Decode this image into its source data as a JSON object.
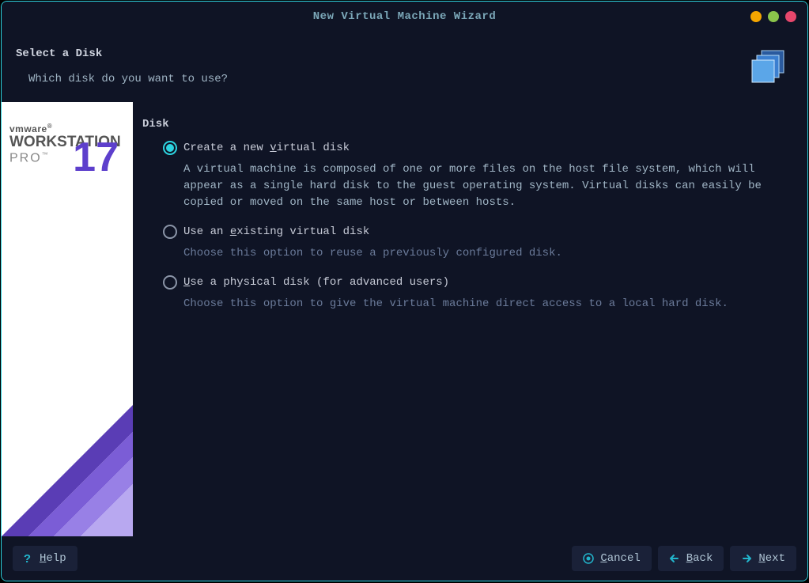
{
  "window": {
    "title": "New Virtual Machine Wizard"
  },
  "header": {
    "title": "Select a Disk",
    "subtitle": "Which disk do you want to use?"
  },
  "sidebar": {
    "brand_small": "vmware",
    "brand_big": "WORKSTATION",
    "brand_pro": "PRO",
    "version": "17"
  },
  "content": {
    "section_title": "Disk",
    "options": [
      {
        "id": "create-new",
        "label_pre": "Create a new ",
        "mnemonic": "v",
        "label_post": "irtual disk",
        "description": "A virtual machine is composed of one or more files on the host file system, which will appear as a single hard disk to the guest operating system. Virtual disks can easily be copied or moved on the same host or between hosts.",
        "selected": true
      },
      {
        "id": "use-existing",
        "label_pre": "Use an ",
        "mnemonic": "e",
        "label_post": "xisting virtual disk",
        "description": "Choose this option to reuse a previously configured disk.",
        "selected": false
      },
      {
        "id": "use-physical",
        "label_pre": "",
        "mnemonic": "U",
        "label_post": "se a physical disk (for advanced users)",
        "description": "Choose this option to give the virtual machine direct access to a local hard disk.",
        "selected": false
      }
    ]
  },
  "footer": {
    "help_label": "elp",
    "help_mnemonic": "H",
    "cancel_label": "ancel",
    "cancel_mnemonic": "C",
    "back_label": "ack",
    "back_mnemonic": "B",
    "next_label": "ext",
    "next_mnemonic": "N"
  }
}
